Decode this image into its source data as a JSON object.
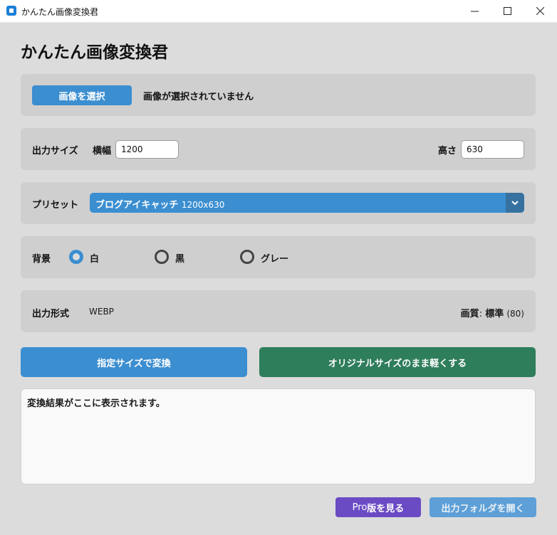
{
  "window": {
    "title": "かんたん画像変換君"
  },
  "heading": "かんたん画像変換君",
  "file": {
    "select_button": "画像を選択",
    "status": "画像が選択されていません"
  },
  "size": {
    "label": "出力サイズ",
    "width_label": "横幅",
    "width_value": "1200",
    "height_label": "高さ",
    "height_value": "630"
  },
  "preset": {
    "label": "プリセット",
    "selected_name": "ブログアイキャッチ",
    "selected_size": "1200x630"
  },
  "background": {
    "label": "背景",
    "options": [
      {
        "label": "白",
        "selected": true
      },
      {
        "label": "黒",
        "selected": false
      },
      {
        "label": "グレー",
        "selected": false
      }
    ]
  },
  "format": {
    "label": "出力形式",
    "value": "WEBP",
    "quality_label": "画質",
    "quality_value": "標準",
    "quality_number": "(80)"
  },
  "actions": {
    "convert": "指定サイズで変換",
    "compress": "オリジナルサイズのまま軽くする"
  },
  "result": {
    "text": "変換結果がここに表示されます。"
  },
  "footer": {
    "pro_prefix": "Pro",
    "pro_suffix": "版を見る",
    "open_folder": "出力フォルダを開く"
  },
  "colors": {
    "accent": "#3b8ed0",
    "accent_dark": "#36719f",
    "green": "#2e7d5b",
    "purple": "#6a4bc4",
    "disabled_blue": "#5d9fd6"
  }
}
